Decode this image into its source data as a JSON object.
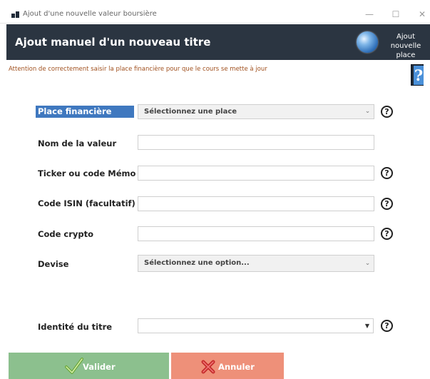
{
  "window": {
    "title": "Ajout d'une nouvelle valeur boursière",
    "controls": [
      "—",
      "☐",
      "✕"
    ]
  },
  "header": {
    "title": "Ajout manuel d'un nouveau titre",
    "add_place_line1": "Ajout nouvelle",
    "add_place_line2": "place"
  },
  "warning": "Attention de correctement saisir la place financière pour que le cours se mette à jour",
  "help": {
    "symbol": "?"
  },
  "form": {
    "place": {
      "label": "Place financière",
      "value": "Sélectionnez une place"
    },
    "nom": {
      "label": "Nom de la valeur",
      "value": ""
    },
    "ticker": {
      "label": "Ticker ou code Mémo",
      "value": ""
    },
    "isin": {
      "label": "Code ISIN (facultatif)",
      "value": ""
    },
    "crypto": {
      "label": "Code crypto",
      "value": ""
    },
    "devise": {
      "label": "Devise",
      "value": "Sélectionnez une option..."
    },
    "identite": {
      "label": "Identité du titre",
      "value": ""
    }
  },
  "buttons": {
    "ok": "Valider",
    "cancel": "Annuler"
  },
  "colors": {
    "header_bg": "#2b3541",
    "highlight_label": "#3f78bf",
    "ok_button": "#8cc08e",
    "cancel_button": "#ee9079",
    "warning_text": "#a0501e"
  }
}
